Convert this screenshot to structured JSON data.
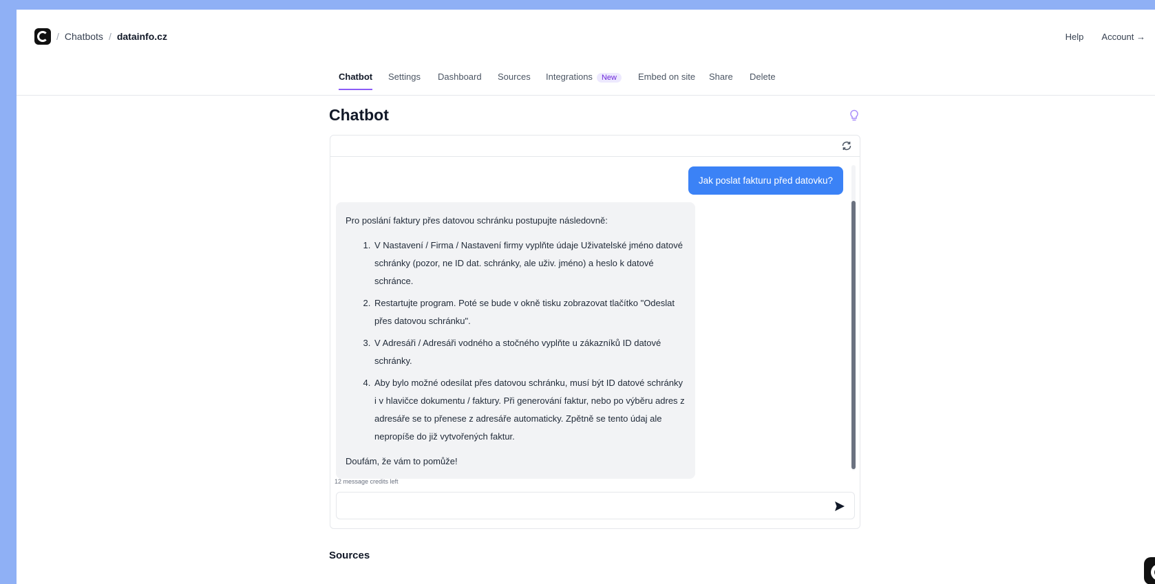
{
  "breadcrumb": {
    "root": "Chatbots",
    "current": "datainfo.cz"
  },
  "header": {
    "help": "Help",
    "account": "Account →"
  },
  "tabs": [
    {
      "label": "Chatbot",
      "active": true
    },
    {
      "label": "Settings"
    },
    {
      "label": "Dashboard"
    },
    {
      "label": "Sources"
    },
    {
      "label": "Integrations",
      "badge": "New"
    },
    {
      "label": "Embed on site"
    },
    {
      "label": "Share"
    },
    {
      "label": "Delete"
    }
  ],
  "page": {
    "title": "Chatbot",
    "sources_heading": "Sources"
  },
  "chat": {
    "user_message": "Jak poslat fakturu před datovku?",
    "bot_intro": "Pro poslání faktury přes datovou schránku postupujte následovně:",
    "bot_steps": [
      "V Nastavení / Firma / Nastavení firmy vyplňte údaje Uživatelské jméno datové schránky (pozor, ne ID dat. schránky, ale uživ. jméno) a heslo k datové schránce.",
      "Restartujte program. Poté se bude v okně tisku zobrazovat tlačítko \"Odeslat přes datovou schránku\".",
      "V Adresáři / Adresáři vodného a stočného vyplňte u zákazníků ID datové schránky.",
      "Aby bylo možné odesílat přes datovou schránku, musí být ID datové schránky i v hlavičce dokumentu / faktury. Při generování faktur, nebo po výběru adres z adresáře se to přenese z adresáře automaticky. Zpětně se tento údaj ale nepropíše do již vytvořených faktur."
    ],
    "bot_outro": "Doufám, že vám to pomůže!",
    "credits": "12 message credits left",
    "input_value": "",
    "input_placeholder": ""
  },
  "colors": {
    "background": "#8fb0f5",
    "accent": "#8b5cf6",
    "user_bubble": "#3b82f6",
    "bot_bubble": "#f2f3f5"
  },
  "icons": [
    "logo-icon",
    "lightbulb-icon",
    "refresh-icon",
    "send-icon",
    "corner-logo-icon"
  ]
}
